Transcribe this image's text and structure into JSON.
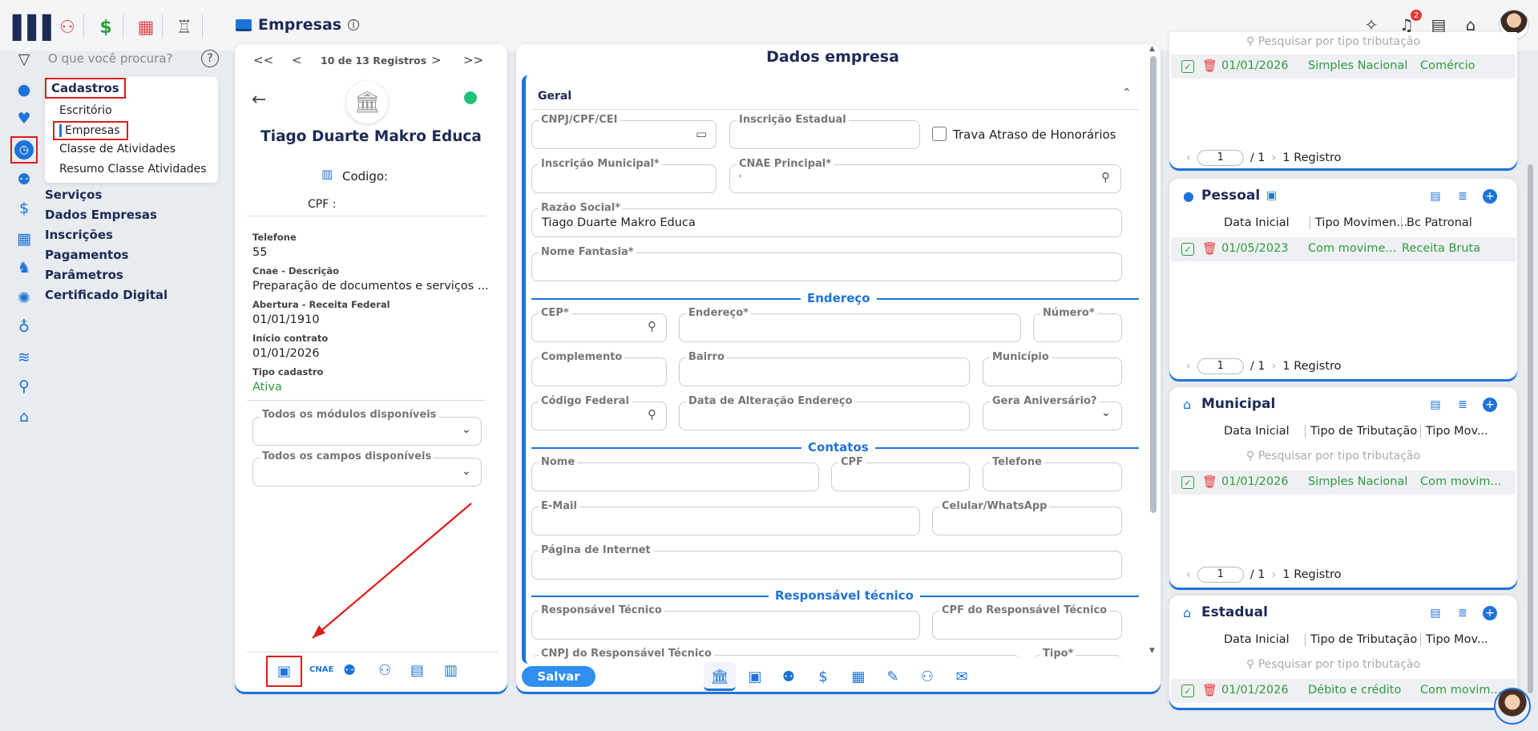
{
  "header": {
    "title": "Empresas",
    "notifications": "2"
  },
  "sidebar": {
    "search_placeholder": "O que você procura?",
    "help": "?",
    "menu": [
      "Cadastros",
      "Serviços",
      "Dados Empresas",
      "Inscrições",
      "Pagamentos",
      "Parâmetros",
      "Certificado Digital"
    ],
    "submenu": [
      "Escritório",
      "Empresas",
      "Classe de Atividades",
      "Resumo Classe Atividades"
    ]
  },
  "nav": {
    "first": "<<",
    "prev": "<",
    "records": "10 de 13 Registros",
    "next": ">",
    "last": ">>"
  },
  "company": {
    "name": "Tiago Duarte Makro Educa",
    "codigo_label": "Codigo:",
    "cpf_label": "CPF :",
    "fields": [
      {
        "label": "Telefone",
        "value": "55"
      },
      {
        "label": "Cnae - Descrição",
        "value": "Preparação de documentos e serviços ..."
      },
      {
        "label": "Abertura - Receita Federal",
        "value": "01/01/1910"
      },
      {
        "label": "Início contrato",
        "value": "01/01/2026"
      },
      {
        "label": "Tipo cadastro",
        "value": "Ativa"
      }
    ],
    "module_select": "Todos os módulos disponíveis",
    "fields_select": "Todos os campos disponíveis",
    "bottom_cnae": "CNAE"
  },
  "form": {
    "title": "Dados empresa",
    "section_general": "Geral",
    "cnpj": "CNPJ/CPF/CEI",
    "insc_estadual": "Inscrição Estadual",
    "trava": "Trava Atraso de Honorários",
    "insc_municipal": "Inscrição Municipal*",
    "cnae_principal": "CNAE Principal*",
    "cnae_value": "'",
    "razao_social": "Razão Social*",
    "razao_value": "Tiago Duarte Makro Educa",
    "nome_fantasia": "Nome Fantasia*",
    "section_endereco": "Endereço",
    "cep": "CEP*",
    "endereco": "Endereço*",
    "numero": "Número*",
    "complemento": "Complemento",
    "bairro": "Bairro",
    "municipio": "Município",
    "codigo_federal": "Código Federal",
    "data_alt": "Data de Alteração Endereço",
    "gera_aniv": "Gera Aniversário?",
    "section_contatos": "Contatos",
    "nome": "Nome",
    "cpf": "CPF",
    "telefone": "Telefone",
    "email": "E-Mail",
    "celular": "Celular/WhatsApp",
    "pagina": "Página de Internet",
    "section_resp": "Responsável técnico",
    "resp_tecnico": "Responsável Técnico",
    "cpf_resp": "CPF do Responsável Técnico",
    "cnpj_resp": "CNPJ do Responsável Técnico",
    "tipo": "Tipo*",
    "save": "Salvar"
  },
  "right": {
    "search_placeholder": "Pesquisar por tipo tributação",
    "top": {
      "row": {
        "date": "01/01/2026",
        "col2": "Simples Nacional",
        "col3": "Comércio"
      },
      "page": "1",
      "of": "/ 1",
      "count": "1 Registro"
    },
    "pessoal": {
      "title": "Pessoal",
      "cols": [
        "Data Inicial",
        "Tipo Movimen...",
        "Bc Patronal"
      ],
      "row": {
        "date": "01/05/2023",
        "col2": "Com movime...",
        "col3": "Receita Bruta"
      },
      "page": "1",
      "of": "/ 1",
      "count": "1 Registro"
    },
    "municipal": {
      "title": "Municipal",
      "cols": [
        "Data Inicial",
        "Tipo de Tributação",
        "Tipo Mov..."
      ],
      "row": {
        "date": "01/01/2026",
        "col2": "Simples Nacional",
        "col3": "Com movim..."
      },
      "page": "1",
      "of": "/ 1",
      "count": "1 Registro"
    },
    "estadual": {
      "title": "Estadual",
      "cols": [
        "Data Inicial",
        "Tipo de Tributação",
        "Tipo Mov..."
      ],
      "row": {
        "date": "01/01/2026",
        "col2": "Débito e crédito",
        "col3": "Com movim..."
      }
    }
  },
  "colors": {
    "accent": "#1e73d8",
    "green": "#2e9d3e",
    "red": "#e01b1b"
  }
}
